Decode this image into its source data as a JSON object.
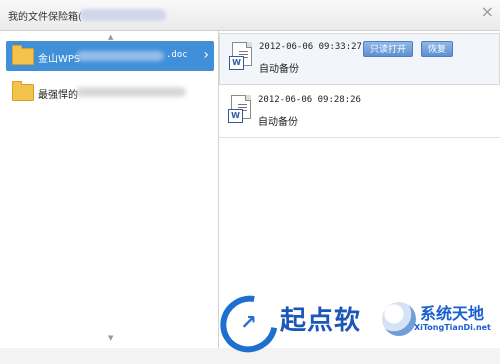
{
  "window": {
    "title": "我的文件保险箱(",
    "close_glyph": "×"
  },
  "folders": [
    {
      "label": "金山WPS",
      "extension": ".doc",
      "selected": true
    },
    {
      "label": "最强悍的",
      "selected": false
    }
  ],
  "scroll": {
    "up_glyph": "▲",
    "down_glyph": "▼"
  },
  "files": [
    {
      "time": "2012-06-06  09:33:27",
      "note": "自动备份",
      "icon": "word-doc-icon",
      "actions": {
        "open_readonly": "只读打开",
        "restore": "恢复"
      }
    },
    {
      "time": "2012-06-06  09:28:26",
      "note": "自动备份",
      "icon": "word-doc-icon"
    }
  ],
  "watermark": {
    "brand_a": "起点软",
    "brand_b": "系统天地",
    "url": "XiTongTianDi.net"
  },
  "colors": {
    "selection": "#3f8fd9",
    "button": "#5d90d2",
    "watermark_blue": "#1a57b8",
    "folder": "#f2c24c"
  }
}
